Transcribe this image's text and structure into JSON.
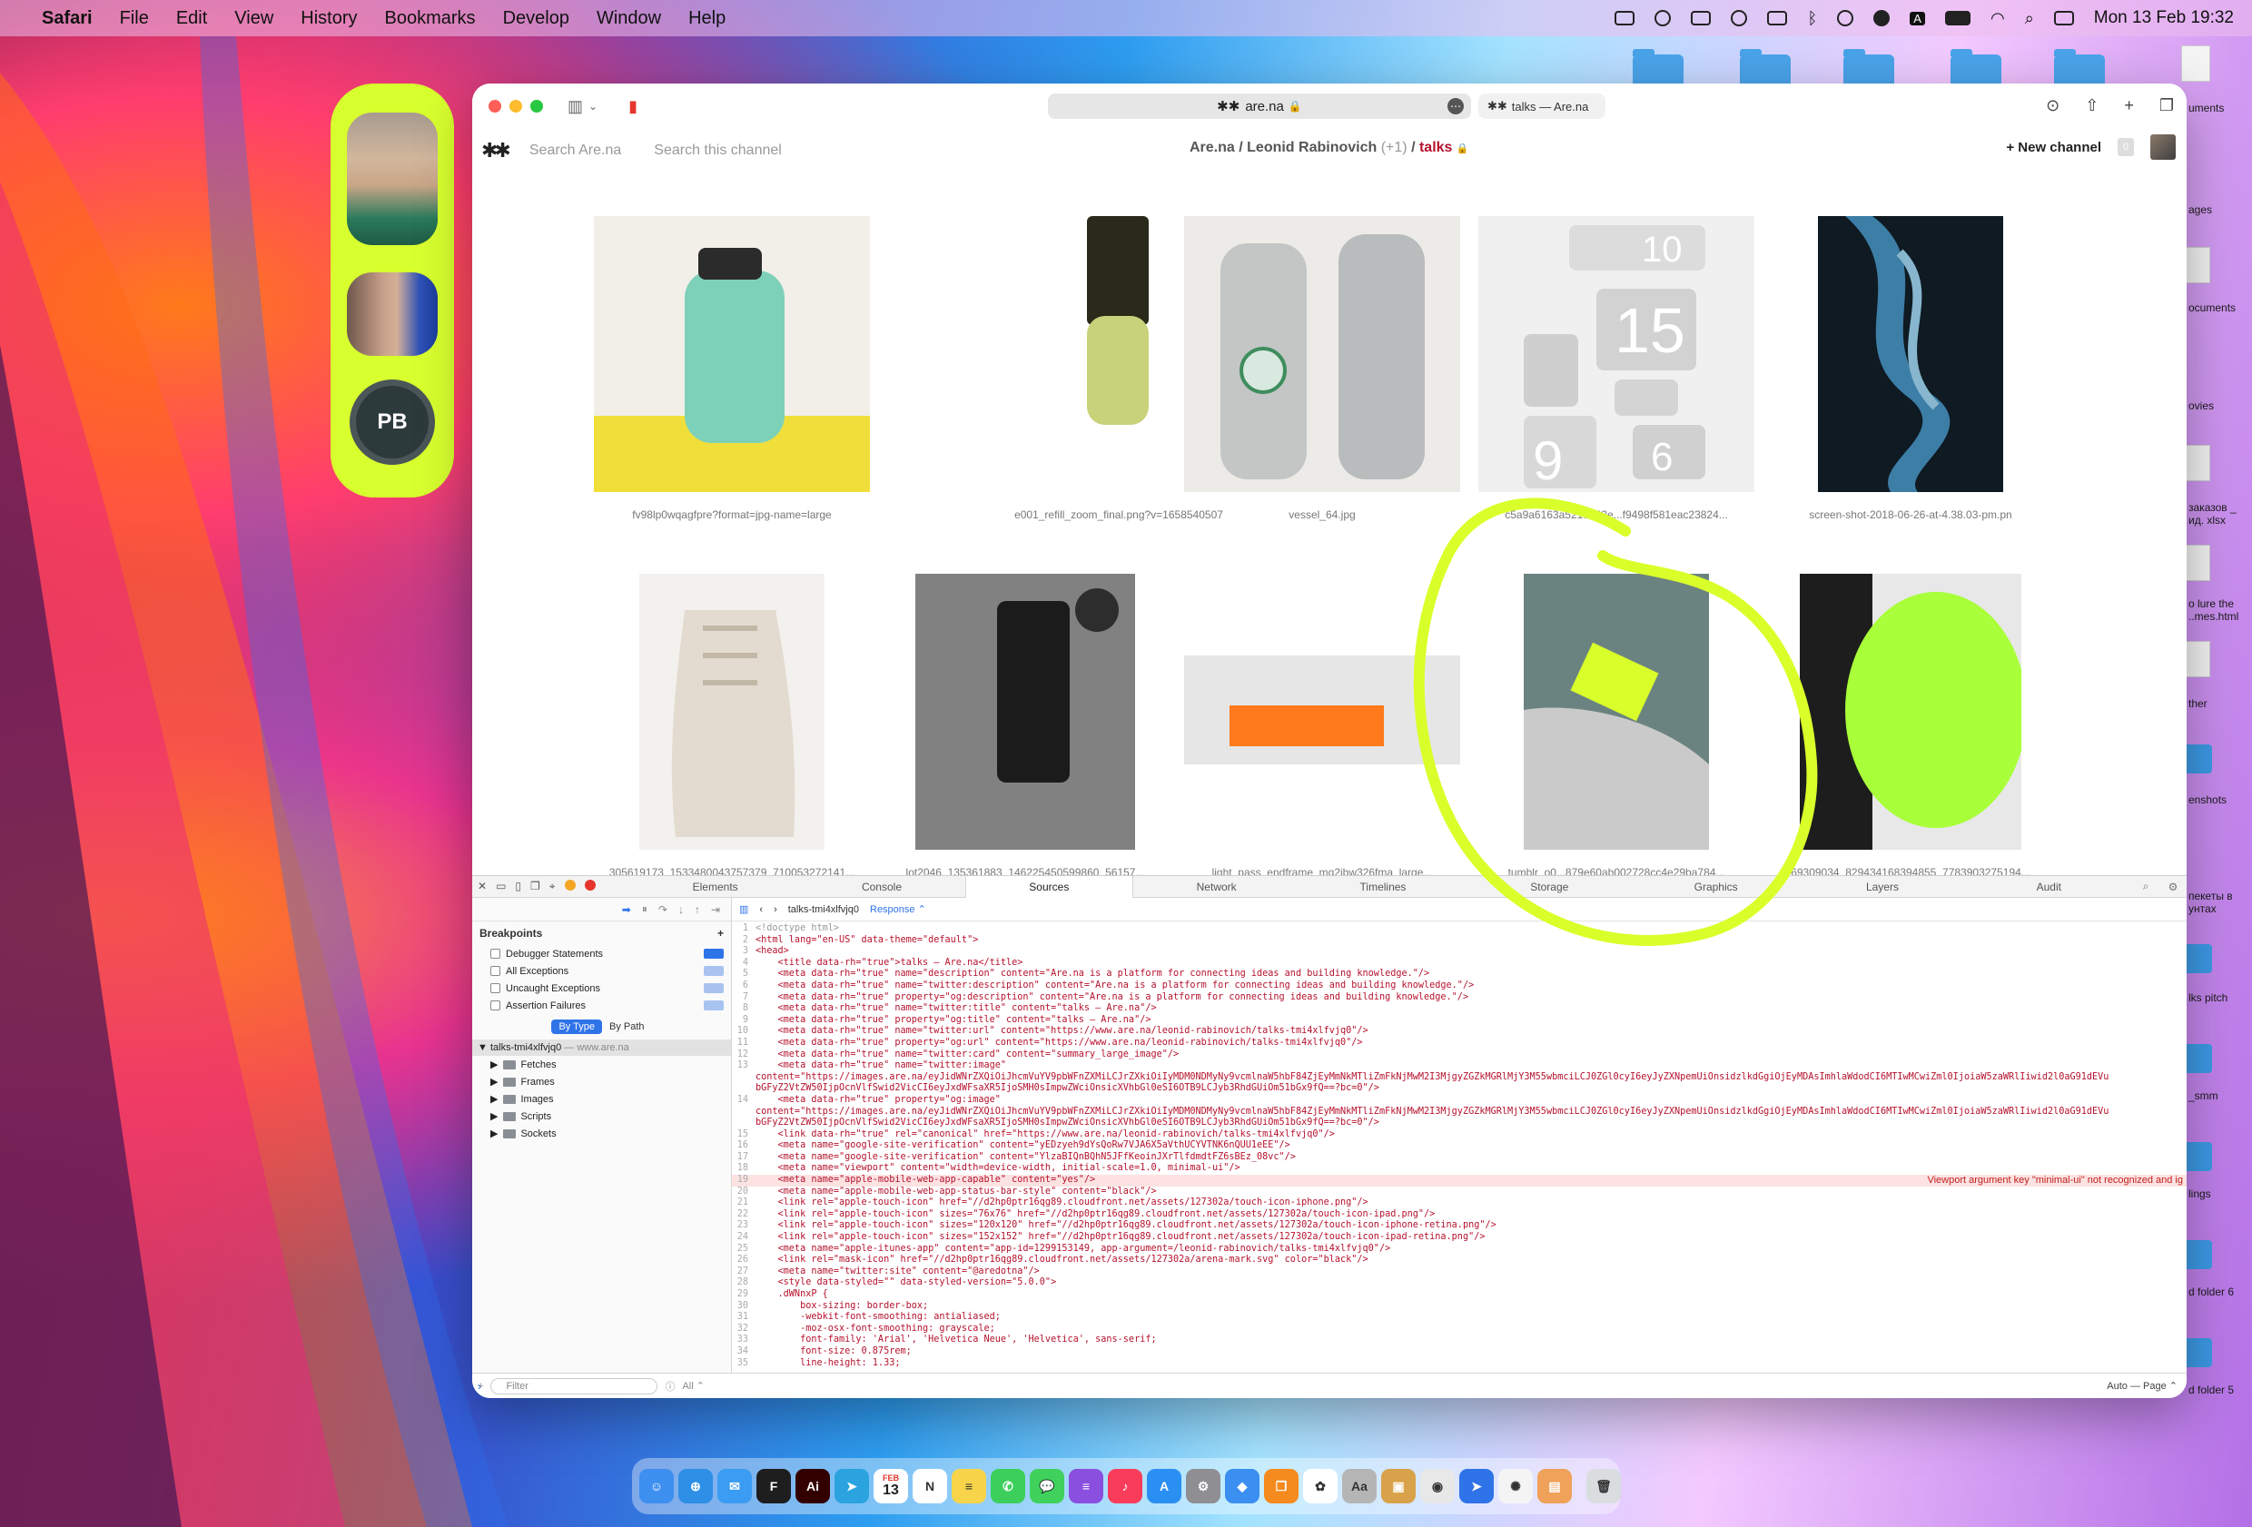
{
  "menubar": {
    "app": "Safari",
    "items": [
      "File",
      "Edit",
      "View",
      "History",
      "Bookmarks",
      "Develop",
      "Window",
      "Help"
    ],
    "clock": "Mon 13 Feb  19:32",
    "input_badge": "A"
  },
  "facetime": {
    "initials": "PB"
  },
  "browser": {
    "url": "are.na",
    "second_tab": "talks — Are.na"
  },
  "arena": {
    "logo": "✱✱",
    "search_placeholder": "Search Are.na",
    "channel_search_placeholder": "Search this channel",
    "breadcrumb": {
      "root": "Are.na",
      "owner": "Leonid Rabinovich",
      "collab_count": "(+1)",
      "channel": "talks"
    },
    "new_channel_label": "+ New channel",
    "notifications": "0",
    "blocks": [
      {
        "caption": "fv98lp0wqagfpre?format=jpg-name=large",
        "colors": [
          "#f2efe9",
          "#7ed1b9",
          "#f0df3a"
        ]
      },
      {
        "caption": "e001_refill_zoom_final.png?v=1658540507",
        "colors": [
          "#ffffff",
          "#c8d27a",
          "#2a2a1a"
        ]
      },
      {
        "caption": "vessel_64.jpg",
        "colors": [
          "#ecebe8",
          "#c4c6c6",
          "#9aa0a0"
        ]
      },
      {
        "caption": "c5a9a6163a5216363e...f9498f581eac23824...",
        "colors": [
          "#f0f0f0",
          "#dcdcdc",
          "#b9b9b9"
        ]
      },
      {
        "caption": "screen-shot-2018-06-26-at-4.38.03-pm.pn",
        "colors": [
          "#0f1a22",
          "#3d7ea6",
          "#88b6cf"
        ]
      },
      {
        "caption": "305619173_1533480043757379_710053272141...",
        "colors": [
          "#f3f1ee",
          "#e3dbcf",
          "#c3b8a8"
        ]
      },
      {
        "caption": "lot2046_135361883_146225450599860_56157...",
        "colors": [
          "#d8d8d8",
          "#3b3b3b",
          "#1b1b1b"
        ]
      },
      {
        "caption": "light_pass_endframe_mq2jbw326fma_large...",
        "colors": [
          "#ffffff",
          "#e6e6e6",
          "#ff7a1c"
        ]
      },
      {
        "caption": "tumblr_o0...879e60ab002728cc4e29ba784...",
        "colors": [
          "#6b8380",
          "#d9ff2a",
          "#c9cac9"
        ]
      },
      {
        "caption": "69309034_829434168394855_7783903275194...",
        "colors": [
          "#1d1d1d",
          "#a8ff3a",
          "#e8e8e8"
        ]
      }
    ]
  },
  "devtools": {
    "tabs": [
      "Elements",
      "Console",
      "Sources",
      "Network",
      "Timelines",
      "Storage",
      "Graphics",
      "Layers",
      "Audit"
    ],
    "active_tab": "Sources",
    "sidebar": {
      "breakpoints_title": "Breakpoints",
      "breakpoints": [
        {
          "label": "Debugger Statements",
          "enabled": true
        },
        {
          "label": "All Exceptions",
          "enabled": false
        },
        {
          "label": "Uncaught Exceptions",
          "enabled": false
        },
        {
          "label": "Assertion Failures",
          "enabled": false
        }
      ],
      "group_by": [
        "By Type",
        "By Path"
      ],
      "resource_root": "talks-tmi4xlfvjq0",
      "resource_host": "— www.are.na",
      "folders": [
        "Fetches",
        "Frames",
        "Images",
        "Scripts",
        "Sockets"
      ],
      "filter_placeholder": "Filter",
      "filter_scope": "All ⌃"
    },
    "editor": {
      "file": "talks-tmi4xlfvjq0",
      "mode": "Response ⌃",
      "error_message": "Viewport argument key \"minimal-ui\" not recognized and ig",
      "footer": "Auto — Page ⌃",
      "lines": [
        {
          "n": "1",
          "t": "<!doctype html>"
        },
        {
          "n": "2",
          "t": "<html lang=\"en-US\" data-theme=\"default\">"
        },
        {
          "n": "3",
          "t": "<head>"
        },
        {
          "n": "4",
          "t": "    <title data-rh=\"true\">talks — Are.na</title>"
        },
        {
          "n": "5",
          "t": "    <meta data-rh=\"true\" name=\"description\" content=\"Are.na is a platform for connecting ideas and building knowledge.\"/>"
        },
        {
          "n": "6",
          "t": "    <meta data-rh=\"true\" name=\"twitter:description\" content=\"Are.na is a platform for connecting ideas and building knowledge.\"/>"
        },
        {
          "n": "7",
          "t": "    <meta data-rh=\"true\" property=\"og:description\" content=\"Are.na is a platform for connecting ideas and building knowledge.\"/>"
        },
        {
          "n": "8",
          "t": "    <meta data-rh=\"true\" name=\"twitter:title\" content=\"talks — Are.na\"/>"
        },
        {
          "n": "9",
          "t": "    <meta data-rh=\"true\" property=\"og:title\" content=\"talks — Are.na\"/>"
        },
        {
          "n": "10",
          "t": "    <meta data-rh=\"true\" name=\"twitter:url\" content=\"https://www.are.na/leonid-rabinovich/talks-tmi4xlfvjq0\"/>"
        },
        {
          "n": "11",
          "t": "    <meta data-rh=\"true\" property=\"og:url\" content=\"https://www.are.na/leonid-rabinovich/talks-tmi4xlfvjq0\"/>"
        },
        {
          "n": "12",
          "t": "    <meta data-rh=\"true\" name=\"twitter:card\" content=\"summary_large_image\"/>"
        },
        {
          "n": "13",
          "t": "    <meta data-rh=\"true\" name=\"twitter:image\""
        },
        {
          "n": "",
          "t": "content=\"https://images.are.na/eyJidWNrZXQiOiJhcmVuYV9pbWFnZXMiLCJrZXkiOiIyMDM0NDMyNy9vcmlnaW5hbF84ZjEyMmNkMTliZmFkNjMwM2I3MjgyZGZkMGRlMjY3M55wbmciLCJ0ZGl0cyI6eyJyZXNpemUiOnsidzlkdGgiOjEyMDAsImhlaWdodCI6MTIwMCwiZml0IjoiaW5zaWRlIiwid2l0aG91dEVu"
        },
        {
          "n": "",
          "t": "bGFyZ2VtZW50IjpOcnVlfSwid2VicCI6eyJxdWFsaXR5IjoSMH0sImpwZWciOnsicXVhbGl0eSI6OTB9LCJyb3RhdGUiOm51bGx9fQ==?bc=0\"/>"
        },
        {
          "n": "14",
          "t": "    <meta data-rh=\"true\" property=\"og:image\""
        },
        {
          "n": "",
          "t": "content=\"https://images.are.na/eyJidWNrZXQiOiJhcmVuYV9pbWFnZXMiLCJrZXkiOiIyMDM0NDMyNy9vcmlnaW5hbF84ZjEyMmNkMTliZmFkNjMwM2I3MjgyZGZkMGRlMjY3M55wbmciLCJ0ZGl0cyI6eyJyZXNpemUiOnsidzlkdGgiOjEyMDAsImhlaWdodCI6MTIwMCwiZml0IjoiaW5zaWRlIiwid2l0aG91dEVu"
        },
        {
          "n": "",
          "t": "bGFyZ2VtZW50IjpOcnVlfSwid2VicCI6eyJxdWFsaXR5IjoSMH0sImpwZWciOnsicXVhbGl0eSI6OTB9LCJyb3RhdGUiOm51bGx9fQ==?bc=0\"/>"
        },
        {
          "n": "15",
          "t": "    <link data-rh=\"true\" rel=\"canonical\" href=\"https://www.are.na/leonid-rabinovich/talks-tmi4xlfvjq0\"/>"
        },
        {
          "n": "16",
          "t": "    <meta name=\"google-site-verification\" content=\"yEDzyeh9dYsQoRw7VJA6X5aVthUCYVTNK6nQUU1eEE\"/>"
        },
        {
          "n": "17",
          "t": "    <meta name=\"google-site-verification\" content=\"YlzaBIQnBQhN5JFfKeoinJXrTlfdmdtFZ6sBEz_08vc\"/>"
        },
        {
          "n": "18",
          "t": "    <meta name=\"viewport\" content=\"width=device-width, initial-scale=1.0, minimal-ui\"/>"
        },
        {
          "n": "19",
          "t": "    <meta name=\"apple-mobile-web-app-capable\" content=\"yes\"/>",
          "error": true
        },
        {
          "n": "20",
          "t": "    <meta name=\"apple-mobile-web-app-status-bar-style\" content=\"black\"/>"
        },
        {
          "n": "21",
          "t": "    <link rel=\"apple-touch-icon\" href=\"//d2hp0ptr16qg89.cloudfront.net/assets/127302a/touch-icon-iphone.png\"/>"
        },
        {
          "n": "22",
          "t": "    <link rel=\"apple-touch-icon\" sizes=\"76x76\" href=\"//d2hp0ptr16qg89.cloudfront.net/assets/127302a/touch-icon-ipad.png\"/>"
        },
        {
          "n": "23",
          "t": "    <link rel=\"apple-touch-icon\" sizes=\"120x120\" href=\"//d2hp0ptr16qg89.cloudfront.net/assets/127302a/touch-icon-iphone-retina.png\"/>"
        },
        {
          "n": "24",
          "t": "    <link rel=\"apple-touch-icon\" sizes=\"152x152\" href=\"//d2hp0ptr16qg89.cloudfront.net/assets/127302a/touch-icon-ipad-retina.png\"/>"
        },
        {
          "n": "25",
          "t": "    <meta name=\"apple-itunes-app\" content=\"app-id=1299153149, app-argument=/leonid-rabinovich/talks-tmi4xlfvjq0\"/>"
        },
        {
          "n": "26",
          "t": "    <link rel=\"mask-icon\" href=\"//d2hp0ptr16qg89.cloudfront.net/assets/127302a/arena-mark.svg\" color=\"black\"/>"
        },
        {
          "n": "27",
          "t": "    <meta name=\"twitter:site\" content=\"@aredotna\"/>"
        },
        {
          "n": "28",
          "t": "    <style data-styled=\"\" data-styled-version=\"5.0.0\">"
        },
        {
          "n": "29",
          "t": "    .dWNnxP {"
        },
        {
          "n": "30",
          "t": "        box-sizing: border-box;"
        },
        {
          "n": "31",
          "t": "        -webkit-font-smoothing: antialiased;"
        },
        {
          "n": "32",
          "t": "        -moz-osx-font-smoothing: grayscale;"
        },
        {
          "n": "33",
          "t": "        font-family: 'Arial', 'Helvetica Neue', 'Helvetica', sans-serif;"
        },
        {
          "n": "34",
          "t": "        font-size: 0.875rem;"
        },
        {
          "n": "35",
          "t": "        line-height: 1.33;"
        }
      ]
    }
  },
  "desktop_labels": [
    "uments",
    "ages",
    "ocuments",
    "ovies",
    "заказов _ ид. xlsx",
    "o lure the ..mes.html",
    "ther",
    "enshots",
    "пекеты в унтах",
    "lks pitch",
    "_smm",
    "lings",
    "d folder 6",
    "d folder 5"
  ],
  "dock": {
    "calendar_day": "13",
    "calendar_month": "FEB",
    "icons": [
      {
        "name": "finder",
        "color": "#3d8ff0",
        "glyph": "☺"
      },
      {
        "name": "safari",
        "color": "#2e8fe6",
        "glyph": "⊕"
      },
      {
        "name": "mail",
        "color": "#3a9cf2",
        "glyph": "✉"
      },
      {
        "name": "figma",
        "color": "#1e1e1e",
        "glyph": "F"
      },
      {
        "name": "illustrator",
        "color": "#330000",
        "glyph": "Ai"
      },
      {
        "name": "telegram",
        "color": "#2aa3df",
        "glyph": "➤"
      },
      {
        "name": "notion",
        "color": "#ffffff",
        "glyph": "N"
      },
      {
        "name": "notes",
        "color": "#f7d44a",
        "glyph": "≡"
      },
      {
        "name": "whatsapp",
        "color": "#3ccf5c",
        "glyph": "✆"
      },
      {
        "name": "messages",
        "color": "#3fd15c",
        "glyph": "💬"
      },
      {
        "name": "speeko",
        "color": "#8b4fe0",
        "glyph": "≡"
      },
      {
        "name": "music",
        "color": "#fa3c5b",
        "glyph": "♪"
      },
      {
        "name": "app-store",
        "color": "#2a8ff2",
        "glyph": "A"
      },
      {
        "name": "system-settings",
        "color": "#8e8e93",
        "glyph": "⚙"
      },
      {
        "name": "keynote",
        "color": "#3b8ff0",
        "glyph": "◆"
      },
      {
        "name": "books",
        "color": "#f58a1f",
        "glyph": "❐"
      },
      {
        "name": "pinwheel",
        "color": "#ffffff",
        "glyph": "✿"
      },
      {
        "name": "dictionary",
        "color": "#b5b5b5",
        "glyph": "Aa"
      },
      {
        "name": "preview",
        "color": "#d8a24a",
        "glyph": "▣"
      },
      {
        "name": "chrome",
        "color": "#e8e8e8",
        "glyph": "◉"
      },
      {
        "name": "transmit",
        "color": "#2f73e8",
        "glyph": "➤"
      },
      {
        "name": "photos",
        "color": "#f4f4f4",
        "glyph": "✺"
      },
      {
        "name": "app-box",
        "color": "#f0a15a",
        "glyph": "▤"
      },
      {
        "name": "trash",
        "color": "#d9dde0",
        "glyph": "🗑"
      }
    ]
  }
}
